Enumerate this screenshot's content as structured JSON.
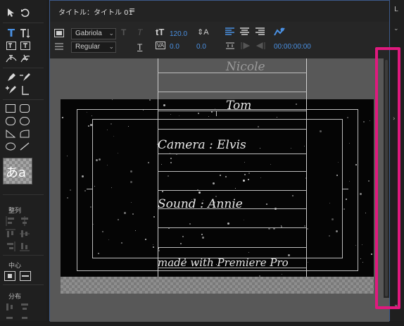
{
  "window": {
    "tab_title": "タイトル：タイトル 01",
    "menu_glyph": "≡"
  },
  "left_panel": {
    "align_label": "整列",
    "center_label": "中心",
    "distribute_label": "分布",
    "text_style_sample": "あa"
  },
  "toolbar": {
    "font_family": "Gabriola",
    "font_style": "Regular",
    "font_size": "120.0",
    "kerning": "0.0",
    "tracking": "0.0",
    "timecode": "00:00:00:00"
  },
  "credits": {
    "line1": "Nicole",
    "line2": "Tom",
    "line3": "Camera   : Elvis",
    "line4": "Sound    : Annie",
    "line5": "made with Premiere Pro"
  },
  "right_panel": {
    "label": "L"
  },
  "colors": {
    "highlight": "#e0197e",
    "accent": "#4a90e2"
  }
}
